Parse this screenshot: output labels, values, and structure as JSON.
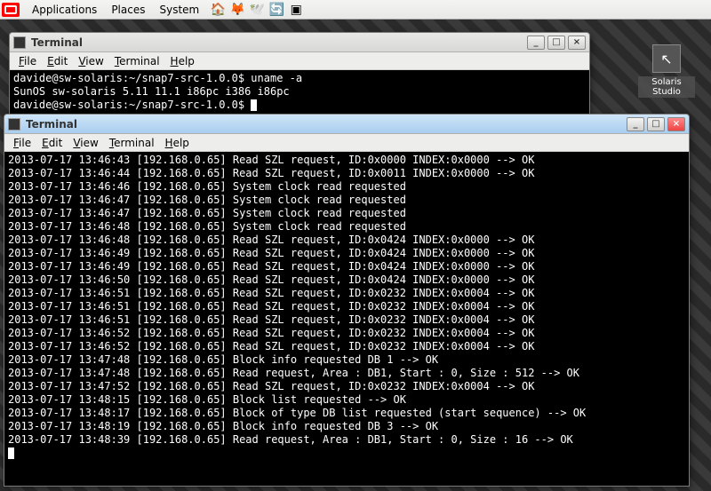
{
  "panel": {
    "apps": "Applications",
    "places": "Places",
    "system": "System"
  },
  "desktop_icon": {
    "label": "Solaris Studio"
  },
  "win1": {
    "title": "Terminal",
    "menu": {
      "file": "File",
      "edit": "Edit",
      "view": "View",
      "terminal": "Terminal",
      "help": "Help"
    },
    "lines": [
      "davide@sw-solaris:~/snap7-src-1.0.0$ uname -a",
      "SunOS sw-solaris 5.11 11.1 i86pc i386 i86pc",
      "davide@sw-solaris:~/snap7-src-1.0.0$ "
    ]
  },
  "win2": {
    "title": "Terminal",
    "menu": {
      "file": "File",
      "edit": "Edit",
      "view": "View",
      "terminal": "Terminal",
      "help": "Help"
    },
    "lines": [
      "2013-07-17 13:46:43 [192.168.0.65] Read SZL request, ID:0x0000 INDEX:0x0000 --> OK",
      "2013-07-17 13:46:44 [192.168.0.65] Read SZL request, ID:0x0011 INDEX:0x0000 --> OK",
      "2013-07-17 13:46:46 [192.168.0.65] System clock read requested",
      "2013-07-17 13:46:47 [192.168.0.65] System clock read requested",
      "2013-07-17 13:46:47 [192.168.0.65] System clock read requested",
      "2013-07-17 13:46:48 [192.168.0.65] System clock read requested",
      "2013-07-17 13:46:48 [192.168.0.65] Read SZL request, ID:0x0424 INDEX:0x0000 --> OK",
      "2013-07-17 13:46:49 [192.168.0.65] Read SZL request, ID:0x0424 INDEX:0x0000 --> OK",
      "2013-07-17 13:46:49 [192.168.0.65] Read SZL request, ID:0x0424 INDEX:0x0000 --> OK",
      "2013-07-17 13:46:50 [192.168.0.65] Read SZL request, ID:0x0424 INDEX:0x0000 --> OK",
      "2013-07-17 13:46:51 [192.168.0.65] Read SZL request, ID:0x0232 INDEX:0x0004 --> OK",
      "2013-07-17 13:46:51 [192.168.0.65] Read SZL request, ID:0x0232 INDEX:0x0004 --> OK",
      "2013-07-17 13:46:51 [192.168.0.65] Read SZL request, ID:0x0232 INDEX:0x0004 --> OK",
      "2013-07-17 13:46:52 [192.168.0.65] Read SZL request, ID:0x0232 INDEX:0x0004 --> OK",
      "2013-07-17 13:46:52 [192.168.0.65] Read SZL request, ID:0x0232 INDEX:0x0004 --> OK",
      "2013-07-17 13:47:48 [192.168.0.65] Block info requested DB 1 --> OK",
      "2013-07-17 13:47:48 [192.168.0.65] Read request, Area : DB1, Start : 0, Size : 512 --> OK",
      "2013-07-17 13:47:52 [192.168.0.65] Read SZL request, ID:0x0232 INDEX:0x0004 --> OK",
      "2013-07-17 13:48:15 [192.168.0.65] Block list requested --> OK",
      "2013-07-17 13:48:17 [192.168.0.65] Block of type DB list requested (start sequence) --> OK",
      "2013-07-17 13:48:19 [192.168.0.65] Block info requested DB 3 --> OK",
      "2013-07-17 13:48:39 [192.168.0.65] Read request, Area : DB1, Start : 0, Size : 16 --> OK"
    ]
  }
}
